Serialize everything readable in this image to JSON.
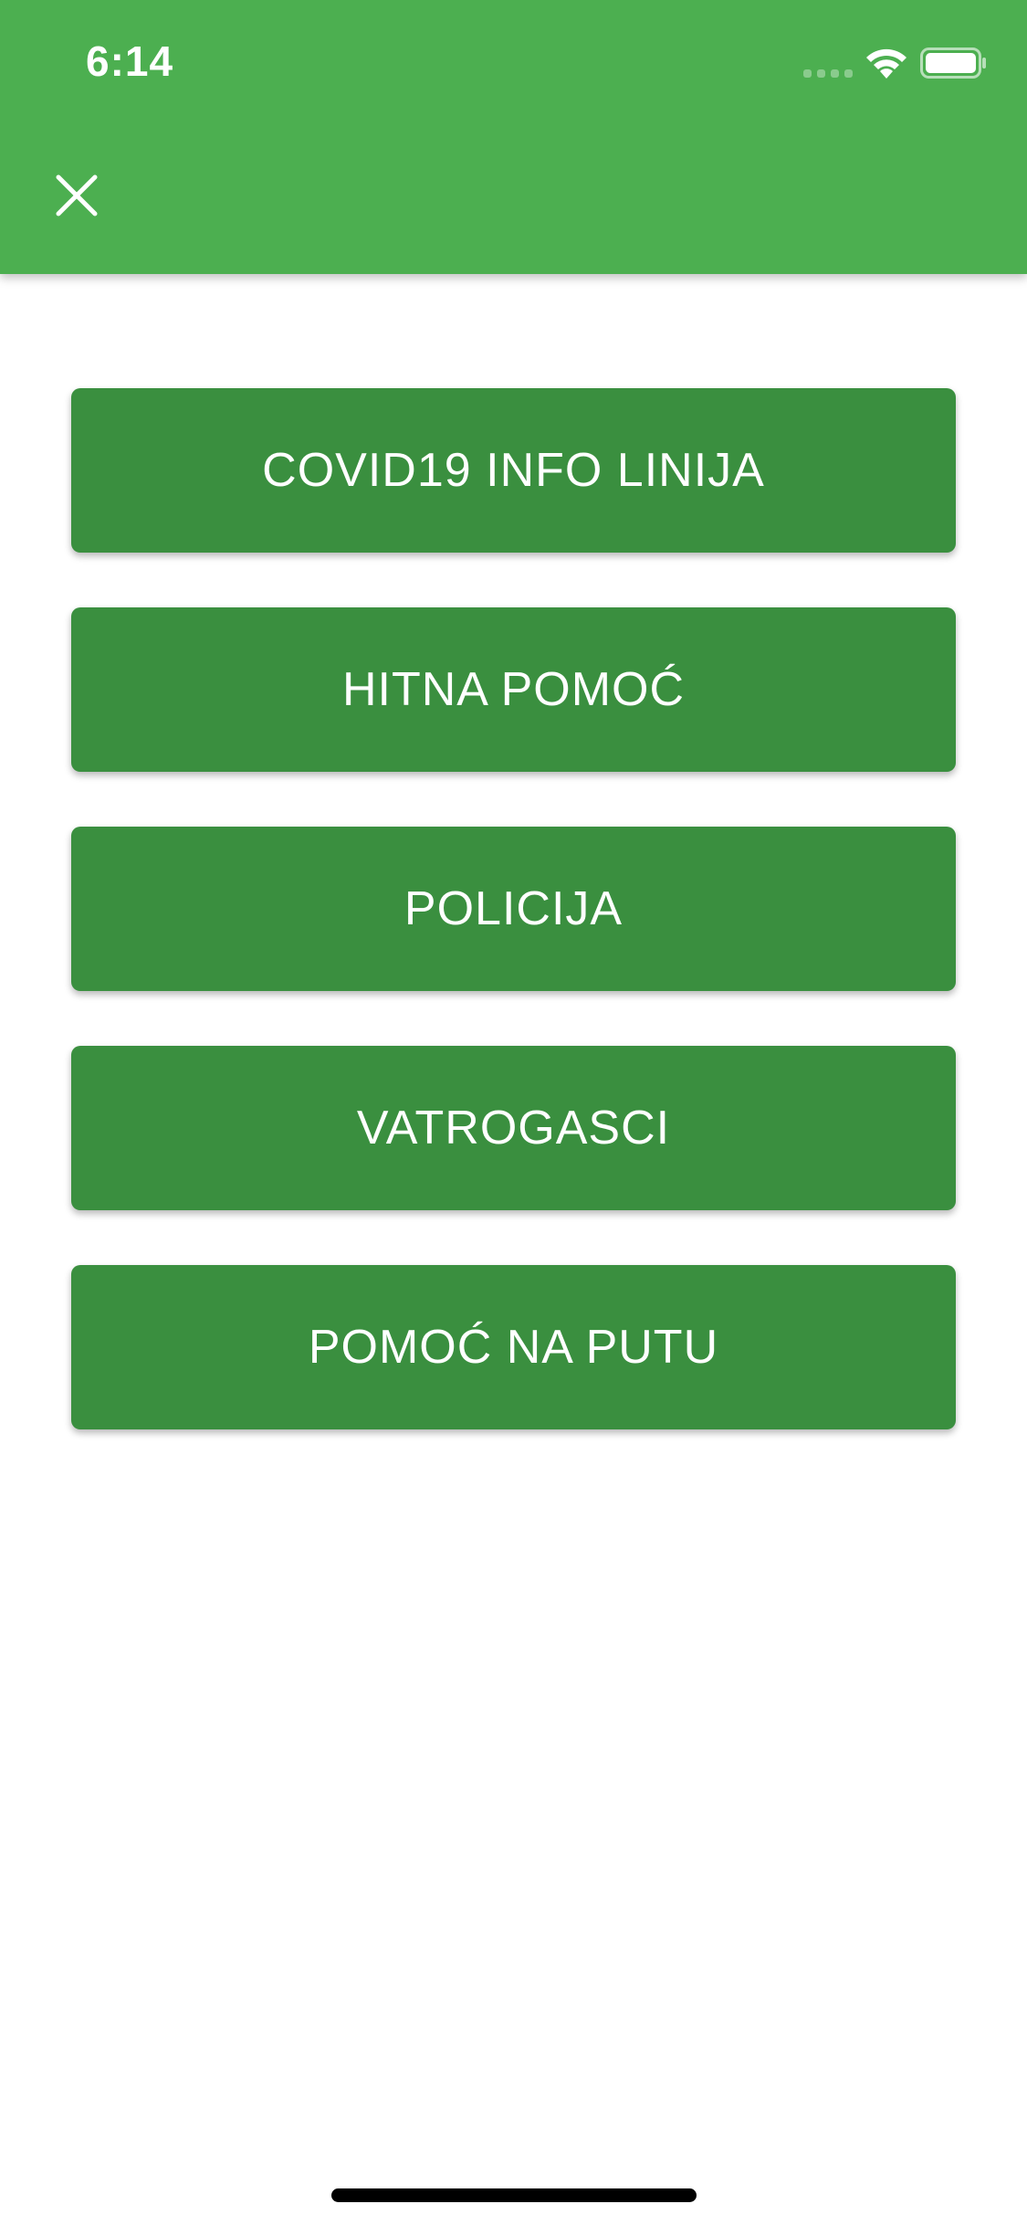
{
  "status_bar": {
    "time": "6:14"
  },
  "header": {
    "background_color": "#4caf50",
    "close_icon": "close-icon"
  },
  "actions": [
    {
      "label": "COVID19 INFO LINIJA"
    },
    {
      "label": "HITNA POMOĆ"
    },
    {
      "label": "POLICIJA"
    },
    {
      "label": "VATROGASCI"
    },
    {
      "label": "POMOĆ NA PUTU"
    }
  ],
  "colors": {
    "header": "#4caf50",
    "button": "#3a8f3f",
    "button_text": "#ffffff"
  }
}
